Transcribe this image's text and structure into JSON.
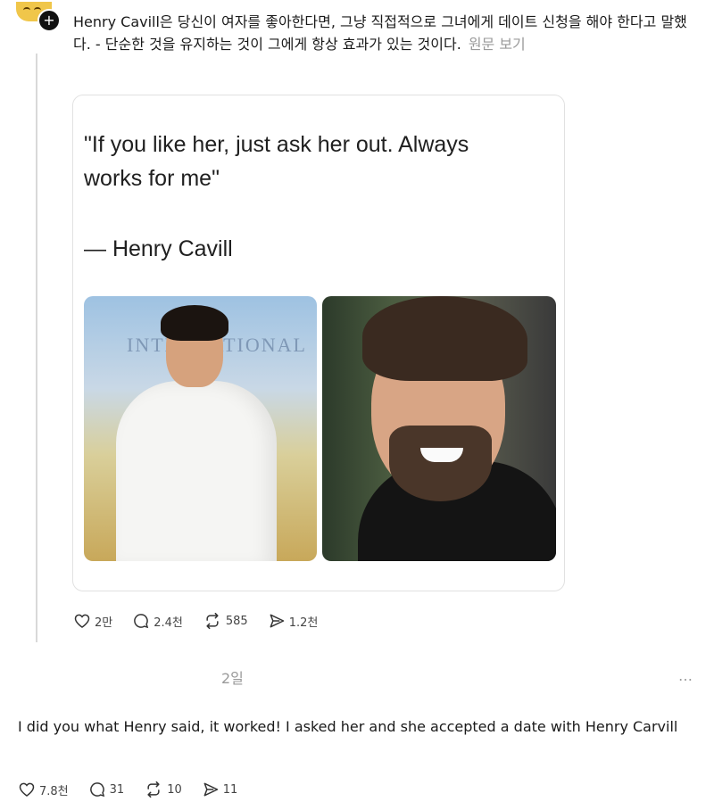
{
  "post": {
    "text": "Henry Cavill은 당신이 여자를 좋아한다면, 그냥 직접적으로 그녀에게 데이트 신청을 해야 한다고 말했다. - 단순한 것을 유지하는 것이 그에게 항상 효과가 있는 것이다.",
    "see_original": "원문 보기",
    "quote": {
      "line1": "\"If you like her, just ask her out. Always",
      "line2": "works for me\"",
      "attribution": "— Henry Cavill"
    },
    "backdrop_text": "INTERNATIONAL",
    "stats": {
      "likes": "2만",
      "replies": "2.4천",
      "reposts": "585",
      "shares": "1.2천"
    }
  },
  "reply": {
    "timestamp": "2일",
    "more": "…",
    "text": "I did you what Henry said, it worked! I asked her and she accepted a date with Henry Carvill",
    "stats": {
      "likes": "7.8천",
      "replies": "31",
      "reposts": "10",
      "shares": "11"
    }
  },
  "icons": [
    "avatar",
    "plus-icon",
    "heart-icon",
    "comment-icon",
    "repost-icon",
    "share-icon",
    "more-icon"
  ],
  "colors": {
    "text": "#1a1a1a",
    "muted": "#9a9a9a",
    "border": "#e1e1e1",
    "thread_line": "#d9d9d9"
  }
}
